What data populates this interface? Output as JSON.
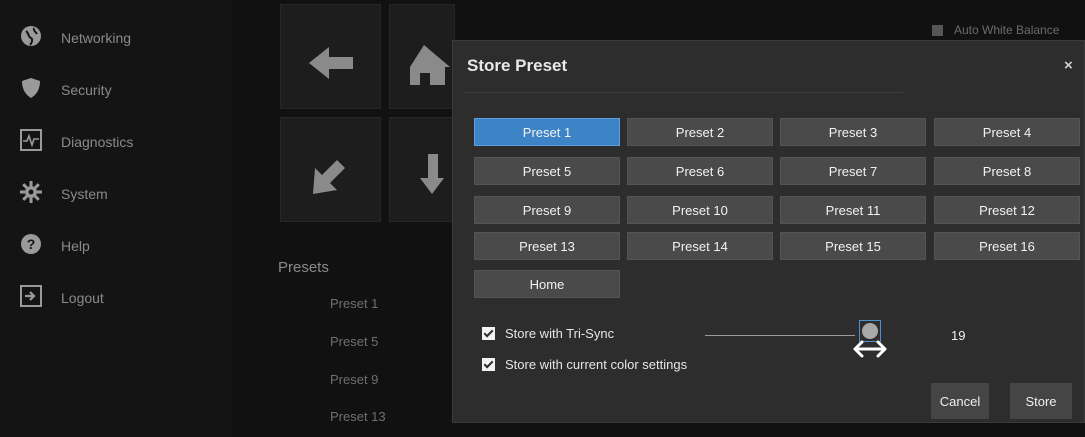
{
  "sidebar": {
    "items": [
      {
        "label": "Networking",
        "icon": "globe-icon"
      },
      {
        "label": "Security",
        "icon": "shield-icon"
      },
      {
        "label": "Diagnostics",
        "icon": "heartbeat-icon"
      },
      {
        "label": "System",
        "icon": "gear-icon"
      },
      {
        "label": "Help",
        "icon": "question-icon"
      },
      {
        "label": "Logout",
        "icon": "logout-icon"
      }
    ]
  },
  "background": {
    "auto_white_balance_label": "Auto White Balance",
    "presets_title": "Presets",
    "preset_list": [
      "Preset 1",
      "Preset 5",
      "Preset 9",
      "Preset 13"
    ]
  },
  "modal": {
    "title": "Store Preset",
    "close_glyph": "×",
    "presets": [
      "Preset 1",
      "Preset 2",
      "Preset 3",
      "Preset 4",
      "Preset 5",
      "Preset 6",
      "Preset 7",
      "Preset 8",
      "Preset 9",
      "Preset 10",
      "Preset 11",
      "Preset 12",
      "Preset 13",
      "Preset 14",
      "Preset 15",
      "Preset 16",
      "Home"
    ],
    "selected_preset": "Preset 1",
    "options": {
      "tri_sync_label": "Store with Tri-Sync",
      "tri_sync_checked": true,
      "color_label": "Store with current color settings",
      "color_checked": true
    },
    "slider_value": "19",
    "cancel_label": "Cancel",
    "store_label": "Store"
  },
  "colors": {
    "accent": "#3d84c6",
    "modal_bg": "#2d2d2d",
    "button_bg": "#4a4a4a"
  }
}
